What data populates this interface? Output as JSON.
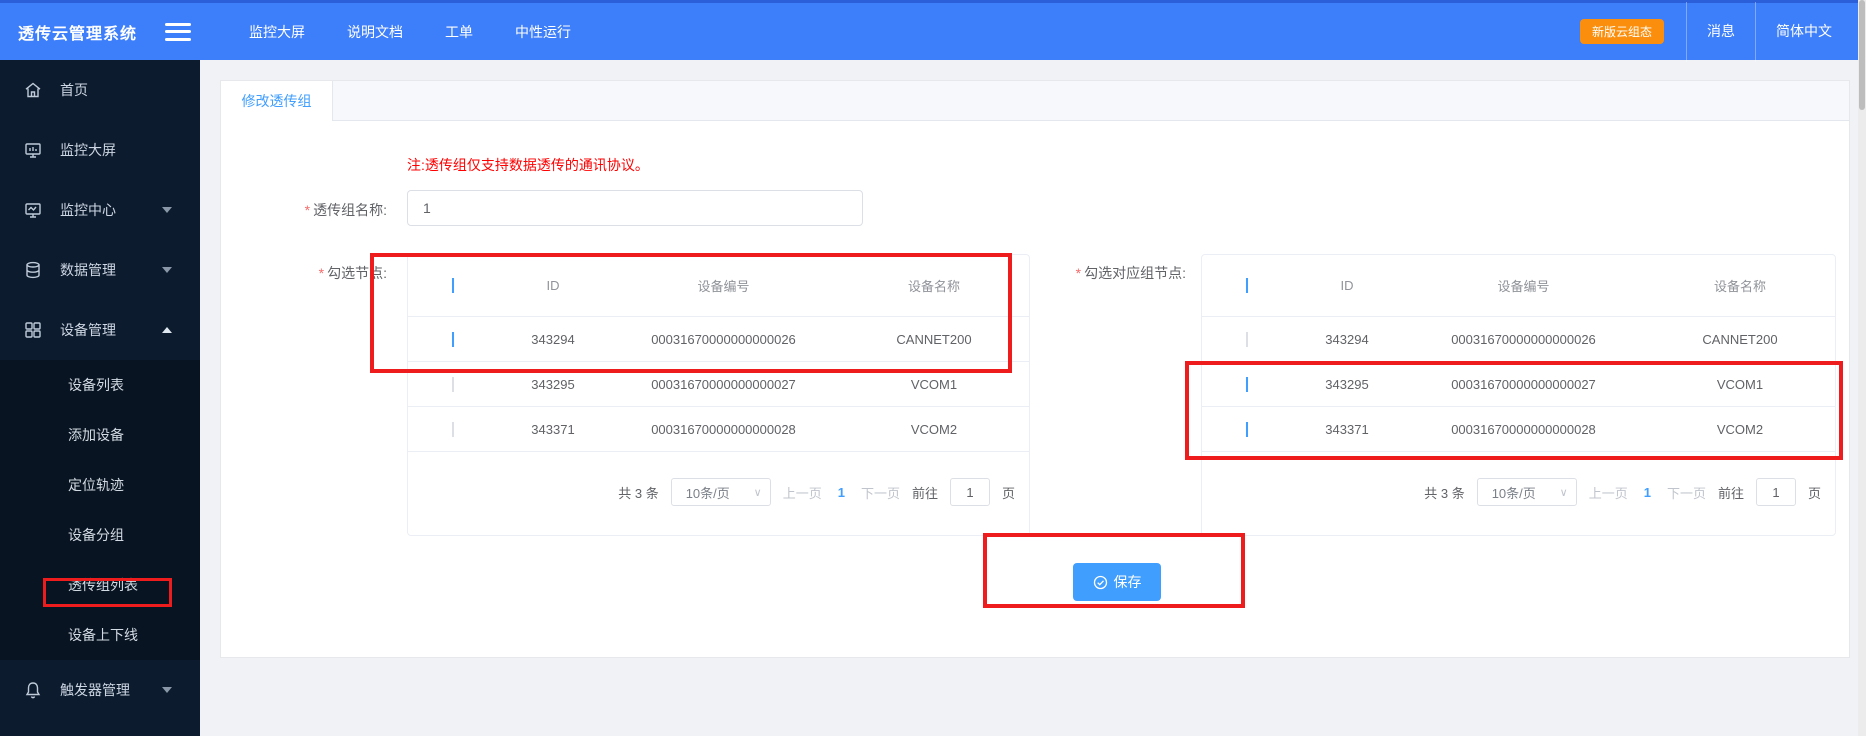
{
  "navbar": {
    "logo": "透传云管理系统",
    "menu": [
      {
        "label": "监控大屏"
      },
      {
        "label": "说明文档"
      },
      {
        "label": "工单"
      },
      {
        "label": "中性运行"
      }
    ],
    "new_scada_button": "新版云组态",
    "messages": "消息",
    "language": "简体中文"
  },
  "sidebar": {
    "items": [
      {
        "label": "首页"
      },
      {
        "label": "监控大屏"
      },
      {
        "label": "监控中心"
      },
      {
        "label": "数据管理"
      },
      {
        "label": "设备管理"
      }
    ],
    "submenu": [
      "设备列表",
      "添加设备",
      "定位轨迹",
      "设备分组",
      "透传组列表",
      "设备上下线"
    ],
    "bottom_item": "触发器管理"
  },
  "tab": {
    "active": "修改透传组"
  },
  "form": {
    "required_mark": "*",
    "note": "注:透传组仅支持数据透传的通讯协议。",
    "name_label": "透传组名称:",
    "name_value": "1",
    "left_section_label": "勾选节点:",
    "right_section_label": "勾选对应组节点:"
  },
  "table_headers": {
    "id": "ID",
    "device_no": "设备编号",
    "device_name": "设备名称"
  },
  "left_table": {
    "header_checkbox_state": "indeterminate",
    "rows": [
      {
        "id": "343294",
        "device_no": "00031670000000000026",
        "device_name": "CANNET200",
        "checked": true
      },
      {
        "id": "343295",
        "device_no": "00031670000000000027",
        "device_name": "VCOM1",
        "checked": false
      },
      {
        "id": "343371",
        "device_no": "00031670000000000028",
        "device_name": "VCOM2",
        "checked": false
      }
    ]
  },
  "right_table": {
    "header_checkbox_state": "checked",
    "rows": [
      {
        "id": "343294",
        "device_no": "00031670000000000026",
        "device_name": "CANNET200",
        "checked": false
      },
      {
        "id": "343295",
        "device_no": "00031670000000000027",
        "device_name": "VCOM1",
        "checked": true
      },
      {
        "id": "343371",
        "device_no": "00031670000000000028",
        "device_name": "VCOM2",
        "checked": true
      }
    ]
  },
  "pagination": {
    "total": "共 3 条",
    "page_size": "10条/页",
    "prev": "上一页",
    "current": "1",
    "next": "下一页",
    "goto_label": "前往",
    "goto_value": "1",
    "goto_unit": "页"
  },
  "save_button": {
    "label": "保存"
  },
  "colors": {
    "navbar_blue": "#3d7efb",
    "sidebar_bg": "#0c1b2d",
    "submenu_bg": "#081421",
    "accent_blue": "#409eff",
    "orange_button": "#fb8f0d",
    "annotation_red": "#ee1c1c",
    "note_red": "#ff0000"
  }
}
